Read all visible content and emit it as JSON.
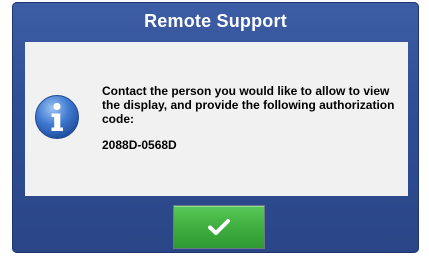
{
  "dialog": {
    "title": "Remote Support",
    "message": "Contact the person you would like to allow to view the display, and provide the following authorization code:",
    "code": "2088D-0568D"
  },
  "icons": {
    "info": "info-icon",
    "confirm": "checkmark-icon"
  },
  "colors": {
    "frame": "#2f4e96",
    "content_bg": "#f1f1f1",
    "ok_button": "#3fae3f",
    "title_text": "#ffffff"
  }
}
